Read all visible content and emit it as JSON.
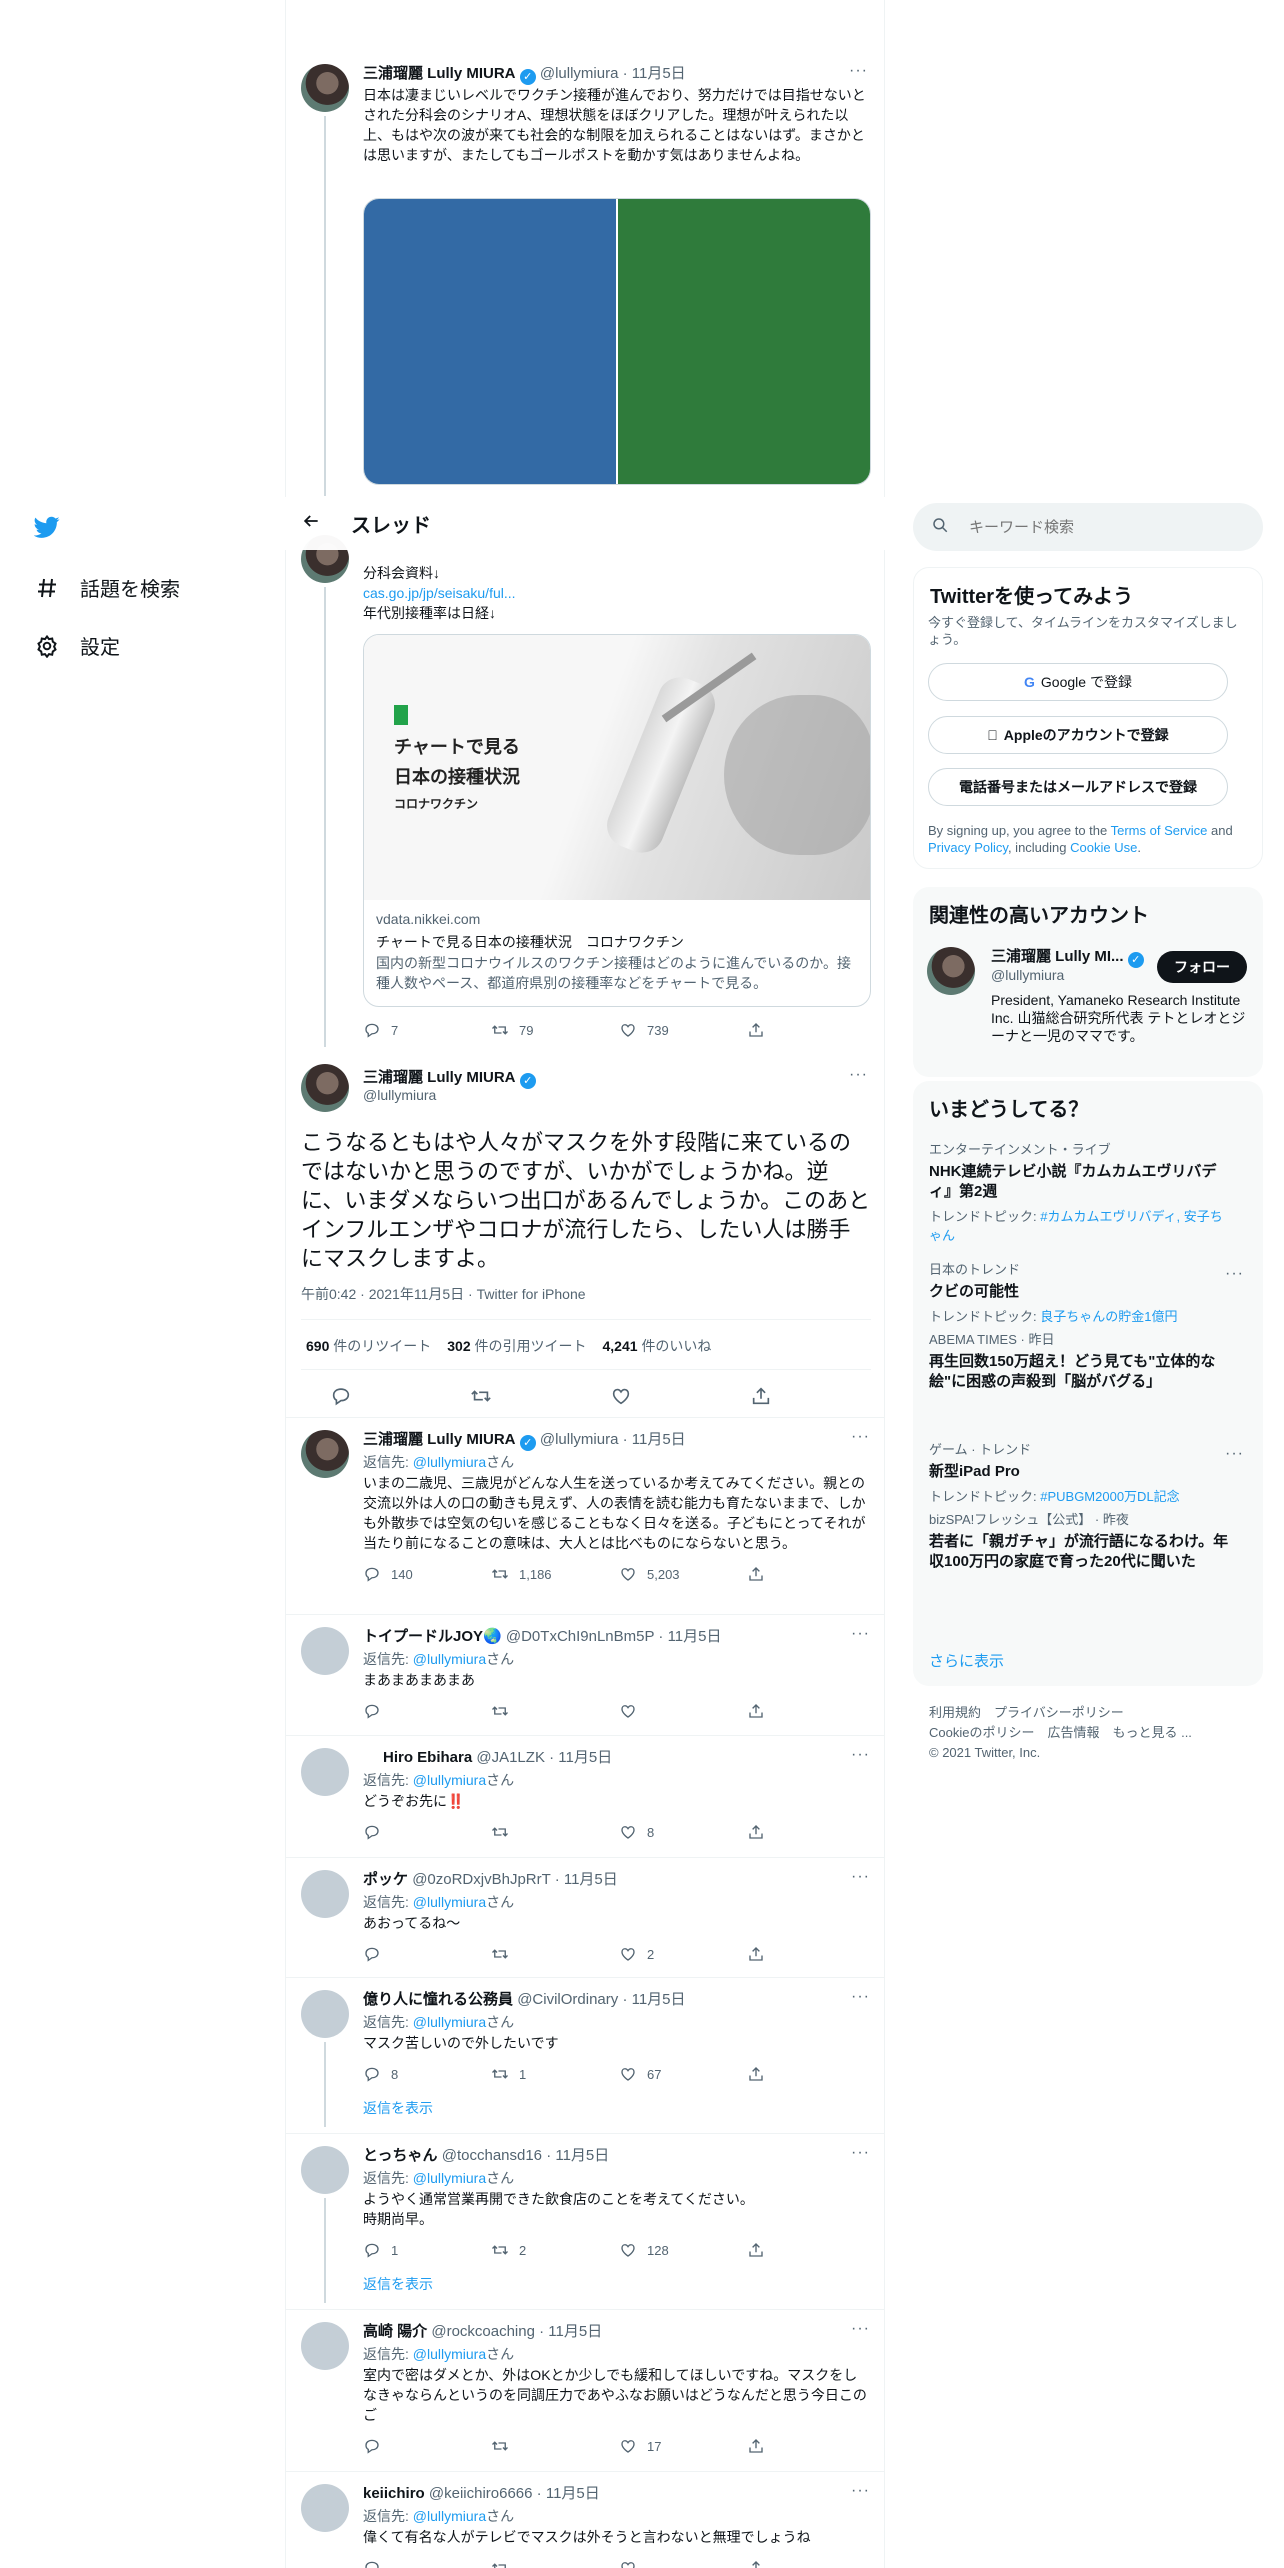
{
  "nav": {
    "explore_label": "話題を検索",
    "settings_label": "設定"
  },
  "header": {
    "title": "スレッド"
  },
  "top_tweet": {
    "name": "三浦瑠麗 Lully MIURA",
    "handle": "@lullymiura",
    "date": "· 11月5日",
    "text": "日本は凄まじいレベルでワクチン接種が進んでおり、努力だけでは目指せないとされた分科会のシナリオA、理想状態をほぼクリアした。理想が叶えられた以上、もはや次の波が来ても社会的な制限を加えられることはないはず。まさかとは思いますが、またしてもゴールポストを動かす気はありませんよね。",
    "image_colors": [
      "#336aa5",
      "#2f7b3b"
    ]
  },
  "second_tweet": {
    "lines": [
      "分科会資料↓",
      "cas.go.jp/jp/seisaku/ful...",
      "年代別接種率は日経↓"
    ],
    "card": {
      "image_title_1": "チャートで見る",
      "image_title_2": "日本の接種状況",
      "image_subtitle": "コロナワクチン",
      "domain": "vdata.nikkei.com",
      "title": "チャートで見る日本の接種状況　コロナワクチン",
      "desc": "国内の新型コロナウイルスのワクチン接種はどのように進んでいるのか。接種人数やペース、都道府県別の接種率などをチャートで見る。"
    },
    "replies": "7",
    "retweets": "79",
    "likes": "739"
  },
  "main_tweet": {
    "name": "三浦瑠麗 Lully MIURA",
    "handle": "@lullymiura",
    "text": "こうなるともはや人々がマスクを外す段階に来ているのではないかと思うのですが、いかがでしょうかね。逆に、いまダメならいつ出口があるんでしょうか。このあとインフルエンザやコロナが流行したら、したい人は勝手にマスクしますよ。",
    "meta": "午前0:42 · 2021年11月5日 · Twitter for iPhone",
    "stats": [
      {
        "num": "690",
        "label": "件のリツイート"
      },
      {
        "num": "302",
        "label": "件の引用ツイート"
      },
      {
        "num": "4,241",
        "label": "件のいいね"
      }
    ]
  },
  "replies": [
    {
      "name": "三浦瑠麗 Lully MIURA",
      "handle": "@lullymiura",
      "date": "· 11月5日",
      "reply_to": "@lullymiura",
      "text": "いまの二歳児、三歳児がどんな人生を送っているか考えてみてください。親との交流以外は人の口の動きも見えず、人の表情を読む能力も育たないままで、しかも外散歩では空気の匂いを感じることもなく日々を送る。子どもにとってそれが当たり前になることの意味は、大人とは比べものにならないと思う。",
      "replies": "140",
      "retweets": "1,186",
      "likes": "5,203"
    },
    {
      "name": "トイプードルJOY🌏",
      "handle": "@D0TxChI9nLnBm5P",
      "date": "· 11月5日",
      "reply_to": "@lullymiura",
      "text": "まあまあまあまあ",
      "replies": "",
      "retweets": "",
      "likes": ""
    },
    {
      "name": "Hiro Ebihara",
      "handle": "@JA1LZK",
      "date": "· 11月5日",
      "reply_to": "@lullymiura",
      "text": "どうぞお先に‼️",
      "replies": "",
      "retweets": "",
      "likes": "8"
    },
    {
      "name": "ポッケ",
      "handle": "@0zoRDxjvBhJpRrT",
      "date": "· 11月5日",
      "reply_to": "@lullymiura",
      "text": "あおってるね～",
      "replies": "",
      "retweets": "",
      "likes": "2"
    },
    {
      "name": "億り人に憧れる公務員",
      "handle": "@CivilOrdinary",
      "date": "· 11月5日",
      "reply_to": "@lullymiura",
      "text": "マスク苦しいので外したいです",
      "replies": "8",
      "retweets": "1",
      "likes": "67",
      "show_replies": "返信を表示"
    },
    {
      "name": "とっちゃん",
      "handle": "@tocchansd16",
      "date": "· 11月5日",
      "reply_to": "@lullymiura",
      "text": "ようやく通常営業再開できた飲食店のことを考えてください。\n時期尚早。",
      "replies": "1",
      "retweets": "2",
      "likes": "128",
      "show_replies": "返信を表示"
    },
    {
      "name": "高崎 陽介",
      "handle": "@rockcoaching",
      "date": "· 11月5日",
      "reply_to": "@lullymiura",
      "text": "室内で密はダメとか、外はOKとか少しでも緩和してほしいですね。マスクをしなきゃならんというのを同調圧力であやふなお願いはどうなんだと思う今日このご",
      "replies": "",
      "retweets": "",
      "likes": "17"
    },
    {
      "name": "keiichiro",
      "handle": "@keiichiro6666",
      "date": "· 11月5日",
      "reply_to": "@lullymiura",
      "text": "偉くて有名な人がテレビでマスクは外そうと言わないと無理でしょうね",
      "replies": "",
      "retweets": "",
      "likes": ""
    }
  ],
  "reply_prefix": "返信先: ",
  "reply_suffix": "さん",
  "search": {
    "placeholder": "キーワード検索"
  },
  "signup": {
    "title": "Twitterを使ってみよう",
    "subtitle": "今すぐ登録して、タイムラインをカスタマイズしましょう。",
    "google": "Google で登録",
    "apple": "Appleのアカウントで登録",
    "phone": "電話番号またはメールアドレスで登録",
    "terms_1": "By signing up, you agree to the ",
    "terms_tos": "Terms of Service",
    "terms_2": " and ",
    "terms_privacy": "Privacy Policy",
    "terms_3": ", including ",
    "terms_cookie": "Cookie Use",
    "terms_4": "."
  },
  "related": {
    "title": "関連性の高いアカウント",
    "name": "三浦瑠麗 Lully MI...",
    "handle": "@lullymiura",
    "follow": "フォロー",
    "bio": "President, Yamaneko Research Institute Inc. 山猫総合研究所代表 テトとレオとジーナと一児のママです。"
  },
  "trends": {
    "title": "いまどうしてる？",
    "items": [
      {
        "cat": "エンターテインメント・ライブ",
        "name": "NHK連続テレビ小説『カムカムエヴリバディ』第2週",
        "sub_label": "トレンドトピック: ",
        "sub_link": "#カムカムエヴリバディ, 安子ちゃん"
      },
      {
        "cat": "日本のトレンド",
        "name": "クビの可能性",
        "sub_label": "トレンドトピック: ",
        "sub_link": "良子ちゃんの貯金1億円"
      },
      {
        "cat": "ABEMA TIMES · 昨日",
        "name": "再生回数150万超え！どう見ても\"立体的な絵\"に困惑の声殺到「脳がバグる」",
        "sub_label": "",
        "sub_link": ""
      },
      {
        "cat": "ゲーム · トレンド",
        "name": "新型iPad Pro",
        "sub_label": "トレンドトピック: ",
        "sub_link": "#PUBGM2000万DL記念"
      },
      {
        "cat": "bizSPA!フレッシュ【公式】 · 昨夜",
        "name": "若者に「親ガチャ」が流行語になるわけ。年収100万円の家庭で育った20代に聞いた",
        "sub_label": "",
        "sub_link": ""
      }
    ],
    "show_more": "さらに表示"
  },
  "footer": {
    "line1": "利用規約　プライバシーポリシー",
    "line2": "Cookieのポリシー　広告情報　もっと見る ...",
    "line3": "© 2021 Twitter, Inc."
  }
}
